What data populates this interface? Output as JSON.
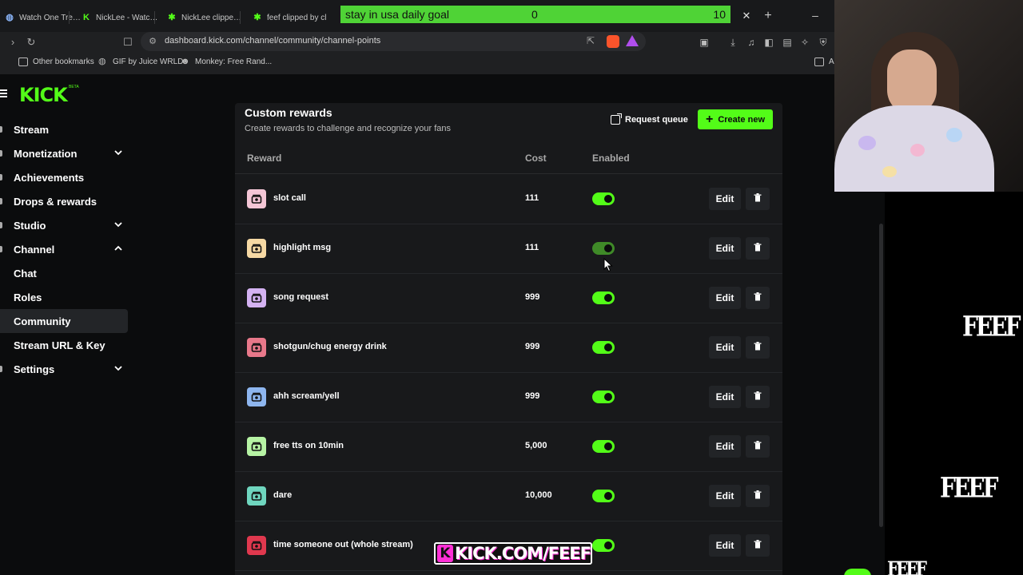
{
  "browser": {
    "tabs": [
      {
        "label": "Watch One Tree H",
        "favicon": "globe-icon"
      },
      {
        "label": "NickLee - Watch c",
        "favicon": "kick-icon"
      },
      {
        "label": "NickLee clipped b",
        "favicon": "kick-icon"
      },
      {
        "label": "feef clipped by cl",
        "favicon": "kick-icon"
      }
    ],
    "url": "dashboard.kick.com/channel/community/channel-points",
    "bookmarks": [
      {
        "label": "Other bookmarks",
        "icon": "folder-icon"
      },
      {
        "label": "GIF by Juice WRLD",
        "icon": "globe-icon"
      },
      {
        "label": "Monkey: Free Rand...",
        "icon": "monkey-icon"
      }
    ],
    "bookmark_overflow": "A"
  },
  "goal_overlay": {
    "title": "stay in usa daily goal",
    "current": "0",
    "target": "10",
    "color": "#4fd336"
  },
  "kick": {
    "logo": "KICK",
    "logo_badge": "BETA",
    "accent": "#53fc18",
    "sidebar": [
      {
        "label": "Stream",
        "chevron": null
      },
      {
        "label": "Monetization",
        "chevron": "down"
      },
      {
        "label": "Achievements",
        "chevron": null
      },
      {
        "label": "Drops & rewards",
        "chevron": null
      },
      {
        "label": "Studio",
        "chevron": "down"
      },
      {
        "label": "Channel",
        "chevron": "up"
      },
      {
        "label": "Chat",
        "chevron": null
      },
      {
        "label": "Roles",
        "chevron": null
      },
      {
        "label": "Community",
        "chevron": null,
        "active": true
      },
      {
        "label": "Stream URL & Key",
        "chevron": null
      },
      {
        "label": "Settings",
        "chevron": "down"
      }
    ],
    "custom_rewards": {
      "title": "Custom rewards",
      "subtitle": "Create rewards to challenge and recognize your fans",
      "request_queue_label": "Request queue",
      "create_new_label": "Create new",
      "columns": {
        "reward": "Reward",
        "cost": "Cost",
        "enabled": "Enabled"
      },
      "edit_label": "Edit",
      "rewards": [
        {
          "title": "slot call",
          "cost": "111",
          "enabled": true,
          "color": "#f4c6d6"
        },
        {
          "title": "highlight msg",
          "cost": "111",
          "enabled": true,
          "color": "#f6d9a4"
        },
        {
          "title": "song request",
          "cost": "999",
          "enabled": true,
          "color": "#d4b2f2"
        },
        {
          "title": "shotgun/chug energy drink",
          "cost": "999",
          "enabled": true,
          "color": "#e8788a"
        },
        {
          "title": "ahh scream/yell",
          "cost": "999",
          "enabled": true,
          "color": "#8eb6ef"
        },
        {
          "title": "free tts on 10min",
          "cost": "5,000",
          "enabled": true,
          "color": "#b6f3a4"
        },
        {
          "title": "dare",
          "cost": "10,000",
          "enabled": true,
          "color": "#6fd6bf"
        },
        {
          "title": "time someone out (whole stream)",
          "cost": "",
          "enabled": true,
          "color": "#e0384e"
        }
      ]
    }
  },
  "stream_overlay": {
    "banner_text": "KICK.COM/FEEF",
    "banner_icon": "K",
    "side_logos": [
      "FEEF",
      "FEEF",
      "FEEF"
    ]
  }
}
